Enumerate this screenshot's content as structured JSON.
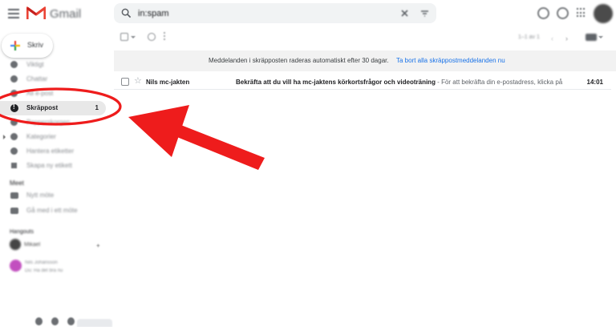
{
  "header": {
    "app_name": "Gmail",
    "search_value": "in:spam"
  },
  "sidebar": {
    "compose_label": "Skriv",
    "items": [
      {
        "label": "Viktigt",
        "icon": "label-important-icon",
        "count": ""
      },
      {
        "label": "Chattar",
        "icon": "chat-icon",
        "count": ""
      },
      {
        "label": "All e-post",
        "icon": "all-mail-icon",
        "count": ""
      },
      {
        "label": "Skräppost",
        "icon": "spam-icon",
        "count": "1",
        "active": true
      },
      {
        "label": "Papperskorgen",
        "icon": "trash-icon",
        "count": ""
      },
      {
        "label": "Kategorier",
        "icon": "label-icon",
        "count": "",
        "expandable": true
      },
      {
        "label": "Hantera etiketter",
        "icon": "gear-icon",
        "count": ""
      },
      {
        "label": "Skapa ny etikett",
        "icon": "plus-icon",
        "count": ""
      }
    ],
    "meet": {
      "title": "Meet",
      "items": [
        {
          "label": "Nytt möte",
          "icon": "video-icon"
        },
        {
          "label": "Gå med i ett möte",
          "icon": "keyboard-icon"
        }
      ]
    },
    "hangouts": {
      "title": "Hangouts",
      "user_name": "Mikael",
      "add_label": "+",
      "contact_name": "Nils Johansson",
      "contact_message": "Du: Ha det bra nu"
    }
  },
  "toolbar": {
    "pager": "1–1 av 1",
    "prev": "‹",
    "next": "›"
  },
  "notice": {
    "text": "Meddelanden i skräpposten raderas automatiskt efter 30 dagar.",
    "link": "Ta bort alla skräppostmeddelanden nu"
  },
  "emails": [
    {
      "sender": "Nils mc-jakten",
      "subject": "Bekräfta att du vill ha mc-jaktens körkortsfrågor och videoträning",
      "snippet": " - För att bekräfta din e-postadress, klicka på ...",
      "time": "14:01"
    }
  ],
  "annotation": {
    "circle_color": "#ee1c1c",
    "arrow_color": "#ee1c1c"
  }
}
